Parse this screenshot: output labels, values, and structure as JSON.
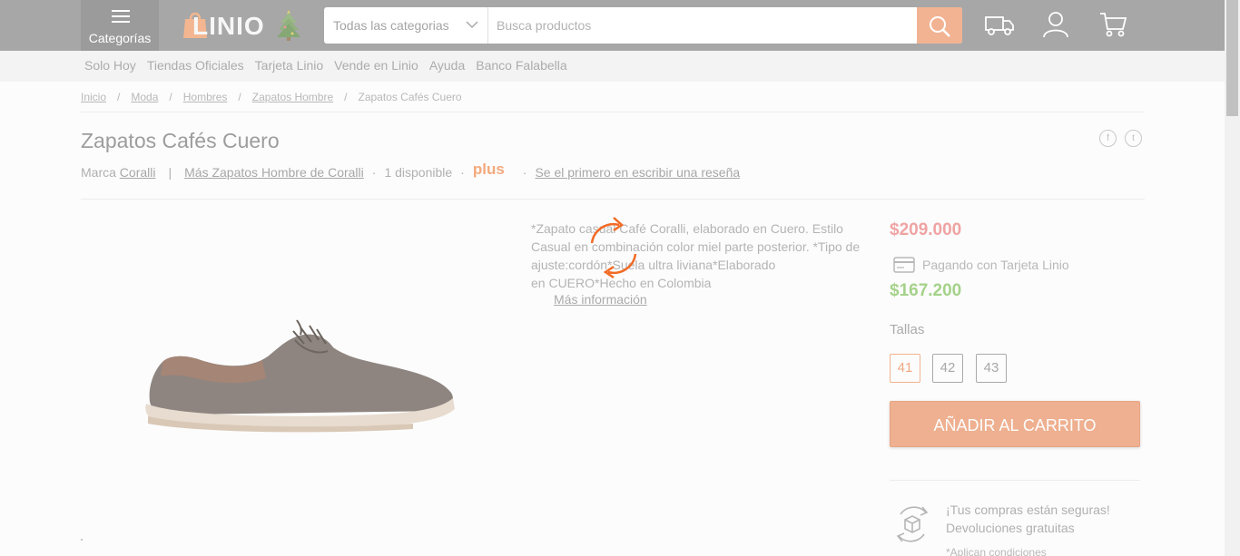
{
  "header": {
    "categories_label": "Categorías",
    "logo_text": "LINIO",
    "search": {
      "category_value": "Todas las categorias",
      "placeholder": "Busca productos"
    },
    "icons": [
      "truck-icon",
      "user-icon",
      "cart-icon"
    ]
  },
  "nav": {
    "items": [
      "Solo Hoy",
      "Tiendas Oficiales",
      "Tarjeta Linio",
      "Vende en Linio",
      "Ayuda",
      "Banco Falabella"
    ]
  },
  "breadcrumb": [
    "Inicio",
    "Moda",
    "Hombres",
    "Zapatos Hombre",
    "Zapatos Cafés Cuero"
  ],
  "product": {
    "title": "Zapatos Cafés Cuero",
    "brand_prefix": "Marca",
    "brand": "Coralli",
    "more_link": "Más Zapatos Hombre de Coralli",
    "stock": "1 disponible",
    "plus": "plus",
    "review_link": "Se el primero en escribir una reseña",
    "description_lines": [
      "*Zapato casual Café Coralli, elaborado en Cuero. Estilo",
      "Casual en combinación color miel parte posterior. *Tipo de",
      "ajuste:cordón*Suela ultra liviana*Elaborado",
      "en CUERO*Hecho en Colombia"
    ],
    "more_info": "Más información",
    "price": "$209.000",
    "card_text": "Pagando con Tarjeta Linio",
    "card_price": "$167.200",
    "sizes_label": "Tallas",
    "sizes": [
      "41",
      "42",
      "43"
    ],
    "selected_size": "41",
    "add_to_cart": "AÑADIR AL CARRITO",
    "secure_lines": [
      "¡Tus compras están seguras!",
      "Devoluciones gratuitas"
    ],
    "conditions": "*Aplican condiciones"
  },
  "colors": {
    "accent": "#f2b393",
    "price": "#f0a3a3",
    "card_price": "#a5d28a"
  }
}
